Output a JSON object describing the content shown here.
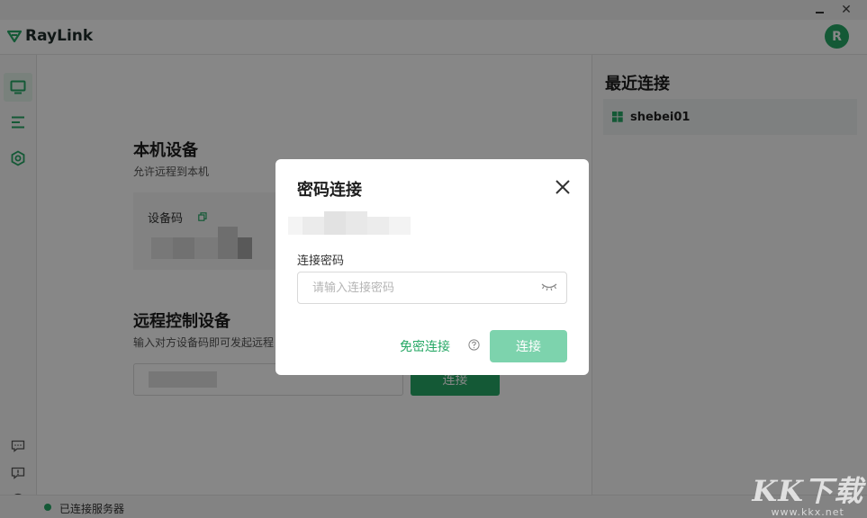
{
  "app": {
    "name": "RayLink",
    "avatar_letter": "R",
    "accent_color": "#27a866"
  },
  "window_controls": {
    "minimize_icon": "minimize-icon",
    "close_icon": "close-icon",
    "close_glyph": "✕"
  },
  "nav": {
    "items": [
      {
        "icon": "monitor-icon",
        "active": true
      },
      {
        "icon": "list-icon",
        "active": false
      },
      {
        "icon": "settings-hexagon-icon",
        "active": false
      }
    ],
    "bottom_items": [
      {
        "icon": "chat-icon"
      },
      {
        "icon": "feedback-icon"
      },
      {
        "icon": "compass-icon"
      }
    ]
  },
  "local_device": {
    "title": "本机设备",
    "subtitle": "允许远程到本机",
    "code_label": "设备码"
  },
  "remote_control": {
    "title": "远程控制设备",
    "subtitle": "输入对方设备码即可发起远程",
    "connect_label": "连接"
  },
  "recent": {
    "title": "最近连接",
    "items": [
      {
        "name": "shebei01",
        "os_icon": "windows-icon"
      }
    ]
  },
  "status": {
    "text": "已连接服务器",
    "dot_color": "#27a866"
  },
  "dialog": {
    "title": "密码连接",
    "password_label": "连接密码",
    "password_placeholder": "请输入连接密码",
    "password_value": "",
    "free_connect_label": "免密连接",
    "connect_label": "连接",
    "connect_color": "#7dd3ad"
  },
  "watermark": {
    "big": "KK下载",
    "small": "www.kkx.net"
  }
}
